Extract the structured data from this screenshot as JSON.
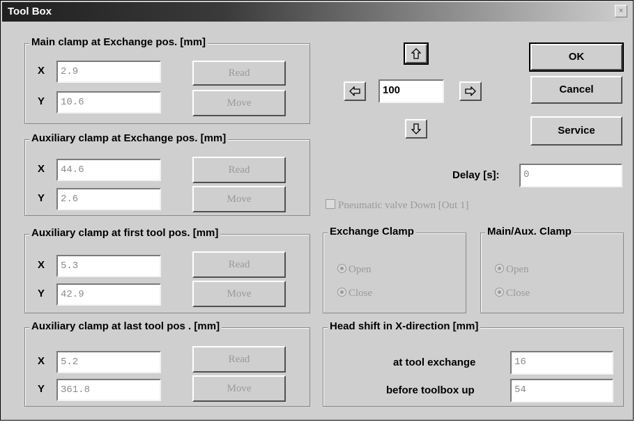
{
  "window": {
    "title": "Tool Box",
    "close_glyph": "×"
  },
  "groups": {
    "main_clamp": {
      "title": "Main clamp at Exchange pos. [mm]",
      "x_label": "X",
      "x_value": "2.9",
      "y_label": "Y",
      "y_value": "10.6",
      "read_label": "Read",
      "move_label": "Move"
    },
    "aux_exchange": {
      "title": "Auxiliary clamp at Exchange pos. [mm]",
      "x_label": "X",
      "x_value": "44.6",
      "y_label": "Y",
      "y_value": "2.6",
      "read_label": "Read",
      "move_label": "Move"
    },
    "aux_first": {
      "title": "Auxiliary clamp at first tool pos. [mm]",
      "x_label": "X",
      "x_value": "5.3",
      "y_label": "Y",
      "y_value": "42.9",
      "read_label": "Read",
      "move_label": "Move"
    },
    "aux_last": {
      "title": "Auxiliary clamp at last tool pos . [mm]",
      "x_label": "X",
      "x_value": "5.2",
      "y_label": "Y",
      "y_value": "361.8",
      "read_label": "Read",
      "move_label": "Move"
    }
  },
  "jog": {
    "step_value": "100",
    "up_icon": "arrow-up-icon",
    "down_icon": "arrow-down-icon",
    "left_icon": "arrow-left-icon",
    "right_icon": "arrow-right-icon"
  },
  "buttons": {
    "ok": "OK",
    "cancel": "Cancel",
    "service": "Service"
  },
  "delay": {
    "label": "Delay [s]:",
    "value": "0"
  },
  "pneumatic": {
    "label": "Pneumatic valve Down [Out 1]",
    "checked": false
  },
  "exchange_clamp": {
    "title": "Exchange Clamp",
    "open": "Open",
    "close": "Close"
  },
  "main_aux_clamp": {
    "title": "Main/Aux. Clamp",
    "open": "Open",
    "close": "Close"
  },
  "head_shift": {
    "title": "Head shift in X-direction [mm]",
    "tool_exchange_label": "at tool exchange",
    "tool_exchange_value": "16",
    "toolbox_up_label": "before toolbox up",
    "toolbox_up_value": "54"
  },
  "colors": {
    "face": "#cfcfcf",
    "disabled_text": "#9a9a9a",
    "title_dark": "#202020"
  }
}
